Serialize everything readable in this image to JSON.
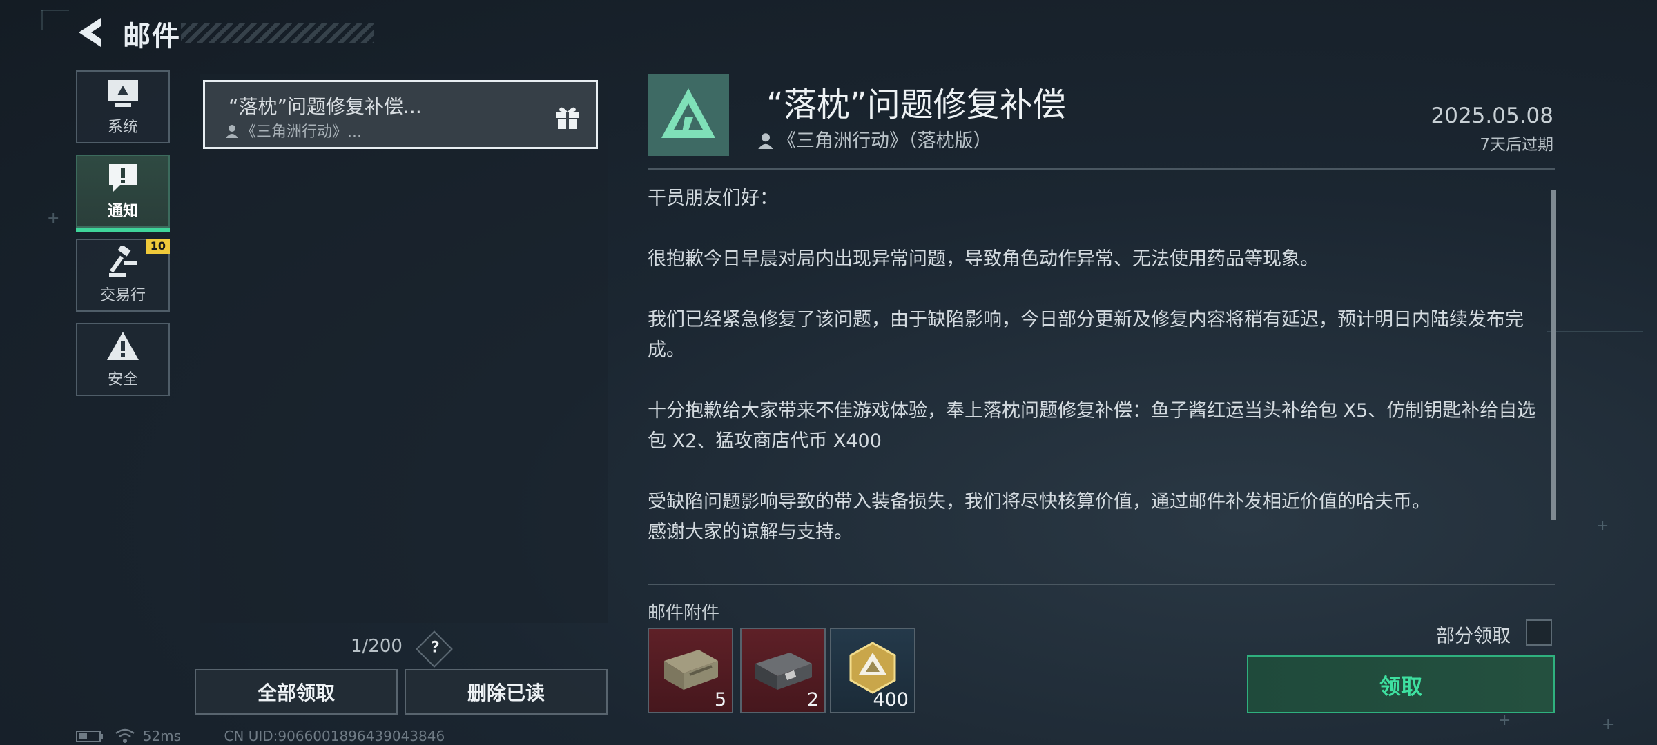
{
  "header": {
    "title": "邮件"
  },
  "categories": [
    {
      "label": "系统",
      "icon": "monitor-icon"
    },
    {
      "label": "通知",
      "icon": "exclamation-icon",
      "active": true
    },
    {
      "label": "交易行",
      "icon": "gavel-icon",
      "badge": "10"
    },
    {
      "label": "安全",
      "icon": "warning-icon"
    }
  ],
  "mail_list": {
    "items": [
      {
        "title": "“落枕”问题修复补偿...",
        "sender": "《三角洲行动》..."
      }
    ],
    "page_count": "1/200",
    "help": "?",
    "claim_all_label": "全部领取",
    "delete_read_label": "删除已读"
  },
  "status": {
    "ping": "52ms",
    "uid": "CN UID:9066001896439043846"
  },
  "mail": {
    "title": "“落枕”问题修复补偿",
    "sender": "《三角洲行动》（落枕版）",
    "date": "2025.05.08",
    "expiry": "7天后过期",
    "body": [
      "干员朋友们好：",
      "很抱歉今日早晨对局内出现异常问题，导致角色动作异常、无法使用药品等现象。",
      "我们已经紧急修复了该问题，由于缺陷影响，今日部分更新及修复内容将稍有延迟，预计明日内陆续发布完成。",
      "十分抱歉给大家带来不佳游戏体验，奉上落枕问题修复补偿：鱼子酱红运当头补给包 X5、仿制钥匙补给自选包 X2、猛攻商店代币 X400",
      "受缺陷问题影响导致的带入装备损失，我们将尽快核算价值，通过邮件补发相近价值的哈夫币。\n感谢大家的谅解与支持。"
    ],
    "attachments_label": "邮件附件",
    "attachments": [
      {
        "icon": "supply-crate-icon",
        "qty": "5",
        "rarity_color": "#5e2027"
      },
      {
        "icon": "key-case-icon",
        "qty": "2",
        "rarity_color": "#5e2027"
      },
      {
        "icon": "token-coin-icon",
        "qty": "400",
        "rarity_color": "#24394a"
      }
    ],
    "partial_claim_label": "部分领取",
    "claim_label": "领取"
  },
  "colors": {
    "accent": "#3fd49a",
    "badge": "#f0c93a"
  }
}
